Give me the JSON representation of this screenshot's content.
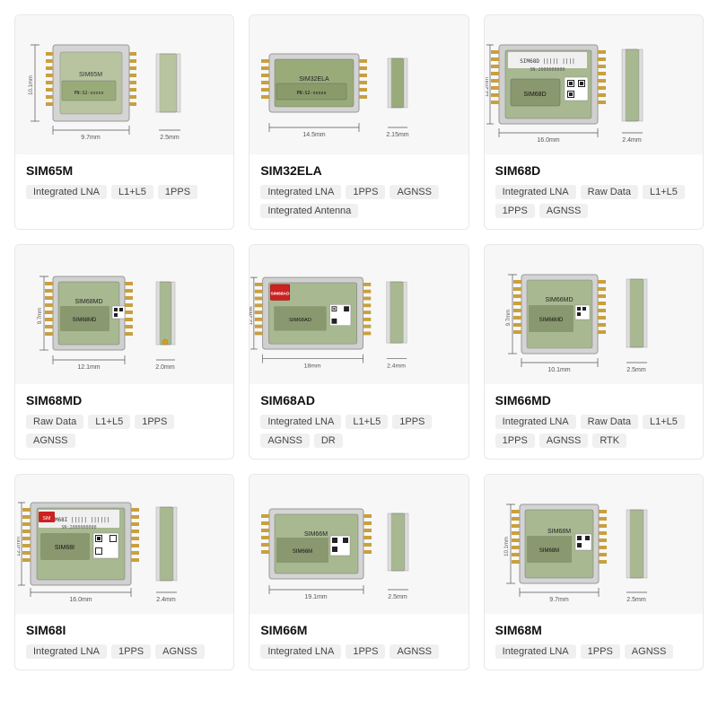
{
  "products": [
    {
      "id": "SIM65M",
      "title": "SIM65M",
      "tags": [
        "Integrated LNA",
        "L1+L5",
        "1PPS"
      ],
      "dims": "9.7mm × 2.5mm",
      "img_type": "module_small"
    },
    {
      "id": "SIM32ELA",
      "title": "SIM32ELA",
      "tags": [
        "Integrated LNA",
        "1PPS",
        "AGNSS",
        "Integrated Antenna"
      ],
      "dims": "14.5mm × 2.15mm",
      "img_type": "module_medium"
    },
    {
      "id": "SIM68D",
      "title": "SIM68D",
      "tags": [
        "Integrated LNA",
        "Raw Data",
        "L1+L5",
        "1PPS",
        "AGNSS"
      ],
      "dims": "16.0mm × 2.4mm",
      "img_type": "module_large"
    },
    {
      "id": "SIM68MD",
      "title": "SIM68MD",
      "tags": [
        "Raw Data",
        "L1+L5",
        "1PPS",
        "AGNSS"
      ],
      "dims": "12.1mm × 2.0mm",
      "img_type": "module_medium2"
    },
    {
      "id": "SIM68AD",
      "title": "SIM68AD",
      "tags": [
        "Integrated LNA",
        "L1+L5",
        "1PPS",
        "AGNSS",
        "DR"
      ],
      "dims": "18mm × 2.4mm",
      "img_type": "module_large2"
    },
    {
      "id": "SIM66MD",
      "title": "SIM66MD",
      "tags": [
        "Integrated LNA",
        "Raw Data",
        "L1+L5",
        "1PPS",
        "AGNSS",
        "RTK"
      ],
      "dims": "10.1mm × 2.5mm",
      "img_type": "module_small2"
    },
    {
      "id": "SIM68I",
      "title": "SIM68I",
      "tags": [
        "Integrated LNA",
        "1PPS",
        "AGNSS"
      ],
      "dims": "16.0mm × 2.4mm",
      "img_type": "module_large3"
    },
    {
      "id": "SIM66M",
      "title": "SIM66M",
      "tags": [
        "Integrated LNA",
        "1PPS",
        "AGNSS"
      ],
      "dims": "19.1mm × 2.5mm",
      "img_type": "module_medium3"
    },
    {
      "id": "SIM68M",
      "title": "SIM68M",
      "tags": [
        "Integrated LNA",
        "1PPS",
        "AGNSS"
      ],
      "dims": "9.7mm × 2.5mm",
      "img_type": "module_small3"
    }
  ]
}
